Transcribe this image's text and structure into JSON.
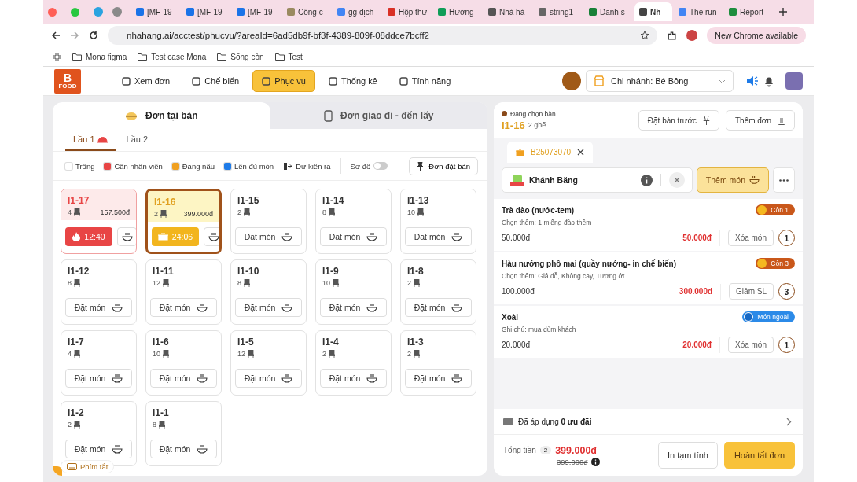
{
  "browser": {
    "pinned_tabs": [
      {
        "color": "#2aa3e0"
      },
      {
        "color": "#8a8a8a"
      }
    ],
    "tabs": [
      {
        "title": "[MF-19",
        "color": "#1a73e8",
        "selected": false
      },
      {
        "title": "[MF-19",
        "color": "#1a73e8",
        "selected": false
      },
      {
        "title": "[MF-19",
        "color": "#1a73e8",
        "selected": false
      },
      {
        "title": "Công c",
        "color": "#9a8a60",
        "selected": false
      },
      {
        "title": "gg dịch",
        "color": "#4285f4",
        "selected": false
      },
      {
        "title": "Hộp thư",
        "color": "#d93025",
        "selected": false
      },
      {
        "title": "Hướng",
        "color": "#0f9d58",
        "selected": false
      },
      {
        "title": "Nhà hà",
        "color": "#555555",
        "selected": false
      },
      {
        "title": "string1",
        "color": "#666666",
        "selected": false
      },
      {
        "title": "Danh s",
        "color": "#188038",
        "selected": false
      },
      {
        "title": "Nh",
        "color": "#444444",
        "selected": true
      },
      {
        "title": "The run",
        "color": "#4285f4",
        "selected": false
      },
      {
        "title": "Report",
        "color": "#1e8e3e",
        "selected": false
      }
    ],
    "address": "nhahang.ai/acctest/phucvu/?areaId=6ad5db9f-bf3f-4389-809f-08ddce7bcff2",
    "update_button": "New Chrome available",
    "bookmarks": [
      "Mona figma",
      "Test case Mona",
      "Sống còn",
      "Test"
    ]
  },
  "header": {
    "logo_letter": "B",
    "logo_caption": "FOOD",
    "nav": [
      {
        "label": "Xem đơn",
        "selected": false
      },
      {
        "label": "Chế biến",
        "selected": false
      },
      {
        "label": "Phục vụ",
        "selected": true
      },
      {
        "label": "Thống kê",
        "selected": false
      },
      {
        "label": "Tính năng",
        "selected": false
      }
    ],
    "branch": "Chi nhánh: Bé Bông"
  },
  "order_tabs": [
    {
      "label": "Đơn tại bàn",
      "selected": true
    },
    {
      "label": "Đơn giao đi - đến lấy",
      "selected": false
    }
  ],
  "floors": [
    {
      "label": "Lầu 1",
      "selected": true,
      "alert": true
    },
    {
      "label": "Lầu 2",
      "selected": false,
      "alert": false
    }
  ],
  "legend": [
    {
      "label": "Trống",
      "kind": "swatch",
      "color": "#ffffff"
    },
    {
      "label": "Cần nhân viên",
      "kind": "swatch",
      "color": "#e84545"
    },
    {
      "label": "Đang nấu",
      "kind": "swatch",
      "color": "#f0a020"
    },
    {
      "label": "Lên đủ món",
      "kind": "swatch",
      "color": "#1e7be8"
    },
    {
      "label": "Dự kiến ra",
      "kind": "exit"
    }
  ],
  "map_toggle": {
    "label": "Sơ đồ",
    "on": false
  },
  "booking_button": "Đơn đặt bàn",
  "tables": [
    {
      "name": "I1-17",
      "seats": "4",
      "kind": "needs_staff",
      "amount": "157.500đ",
      "timer": "12:40",
      "selected": false
    },
    {
      "name": "I1-16",
      "seats": "2",
      "kind": "cooking",
      "amount": "399.000đ",
      "timer": "24:06",
      "selected": true
    },
    {
      "name": "I1-15",
      "seats": "2",
      "kind": "empty",
      "action": "Đặt món",
      "selected": false
    },
    {
      "name": "I1-14",
      "seats": "8",
      "kind": "empty",
      "action": "Đặt món",
      "selected": false
    },
    {
      "name": "I1-13",
      "seats": "10",
      "kind": "empty",
      "action": "Đặt món",
      "selected": false
    },
    {
      "name": "I1-12",
      "seats": "8",
      "kind": "empty",
      "action": "Đặt món",
      "selected": false
    },
    {
      "name": "I1-11",
      "seats": "12",
      "kind": "empty",
      "action": "Đặt món",
      "selected": false
    },
    {
      "name": "I1-10",
      "seats": "8",
      "kind": "empty",
      "action": "Đặt món",
      "selected": false
    },
    {
      "name": "I1-9",
      "seats": "10",
      "kind": "empty",
      "action": "Đặt món",
      "selected": false
    },
    {
      "name": "I1-8",
      "seats": "2",
      "kind": "empty",
      "action": "Đặt món",
      "selected": false
    },
    {
      "name": "I1-7",
      "seats": "4",
      "kind": "empty",
      "action": "Đặt món",
      "selected": false
    },
    {
      "name": "I1-6",
      "seats": "10",
      "kind": "empty",
      "action": "Đặt món",
      "selected": false
    },
    {
      "name": "I1-5",
      "seats": "12",
      "kind": "empty",
      "action": "Đặt món",
      "selected": false
    },
    {
      "name": "I1-4",
      "seats": "2",
      "kind": "empty",
      "action": "Đặt món",
      "selected": false
    },
    {
      "name": "I1-3",
      "seats": "2",
      "kind": "empty",
      "action": "Đặt món",
      "selected": false
    },
    {
      "name": "I1-2",
      "seats": "2",
      "kind": "empty",
      "action": "Đặt món",
      "selected": false
    },
    {
      "name": "I1-1",
      "seats": "8",
      "kind": "empty",
      "action": "Đặt món",
      "selected": false
    }
  ],
  "shortcut_button": "Phím tắt",
  "order": {
    "picking_label": "Đang chọn bàn...",
    "table": "I1-16",
    "seats": "2 ghế",
    "buttons": [
      "Đặt bàn trước",
      "Thêm đơn"
    ],
    "bill_tab": "B25073070",
    "customer": "Khánh Băng",
    "add_button": "Thêm món",
    "items": [
      {
        "name": "Trà đào (nước-tem)",
        "note": "Chọn thêm: 1 miếng đào thêm",
        "price": "50.000đ",
        "total": "50.000đ",
        "action": "Xóa món",
        "qty": "1",
        "badge": {
          "kind": "remaining",
          "text": "Còn 1"
        }
      },
      {
        "name": "Hàu nướng phô mai (quầy nướng- in chế biến)",
        "note": "Chọn thêm: Giá đỗ, Không cay, Tương ớt",
        "price": "100.000đ",
        "total": "300.000đ",
        "action": "Giảm SL",
        "qty": "3",
        "badge": {
          "kind": "remaining",
          "text": "Còn 3"
        }
      },
      {
        "name": "Xoài",
        "note": "Ghi chú: mua dùm khách",
        "price": "20.000đ",
        "total": "20.000đ",
        "action": "Xóa món",
        "qty": "1",
        "badge": {
          "kind": "outside",
          "text": "Món ngoài"
        }
      }
    ],
    "promo": "Đã áp dụng **0 ưu đãi**",
    "total_label": "Tổng tiền",
    "item_count": "2",
    "total": "399.000đ",
    "original_total": "399.000đ",
    "print_button": "In tạm tính",
    "finish_button": "Hoàn tất đơn"
  }
}
